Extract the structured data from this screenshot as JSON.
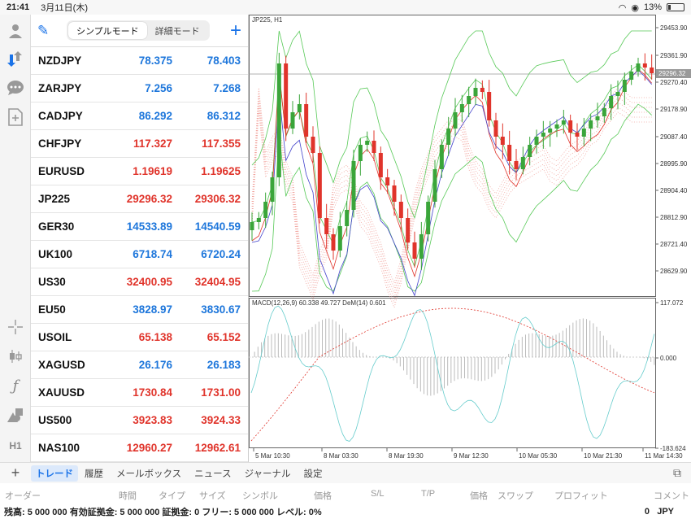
{
  "status_bar": {
    "time": "21:41",
    "date": "3月11日(木)",
    "battery": "13%"
  },
  "toolbar": {
    "items": [
      "account-icon",
      "trade-icon",
      "chat-icon",
      "new-document-icon",
      "crosshair-icon",
      "candlestick-icon",
      "function-icon",
      "objects-icon"
    ],
    "timeframe": "H1"
  },
  "quotes": {
    "mode_simple": "シンプルモード",
    "mode_detail": "詳細モード",
    "rows": [
      {
        "symbol": "NZDJPY",
        "bid": "78.375",
        "ask": "78.403",
        "dir": "up"
      },
      {
        "symbol": "ZARJPY",
        "bid": "7.256",
        "ask": "7.268",
        "dir": "up"
      },
      {
        "symbol": "CADJPY",
        "bid": "86.292",
        "ask": "86.312",
        "dir": "up"
      },
      {
        "symbol": "CHFJPY",
        "bid": "117.327",
        "ask": "117.355",
        "dir": "down"
      },
      {
        "symbol": "EURUSD",
        "bid": "1.19619",
        "ask": "1.19625",
        "dir": "down"
      },
      {
        "symbol": "JP225",
        "bid": "29296.32",
        "ask": "29306.32",
        "dir": "down"
      },
      {
        "symbol": "GER30",
        "bid": "14533.89",
        "ask": "14540.59",
        "dir": "up"
      },
      {
        "symbol": "UK100",
        "bid": "6718.74",
        "ask": "6720.24",
        "dir": "up"
      },
      {
        "symbol": "US30",
        "bid": "32400.95",
        "ask": "32404.95",
        "dir": "down"
      },
      {
        "symbol": "EU50",
        "bid": "3828.97",
        "ask": "3830.67",
        "dir": "up"
      },
      {
        "symbol": "USOIL",
        "bid": "65.138",
        "ask": "65.152",
        "dir": "down"
      },
      {
        "symbol": "XAGUSD",
        "bid": "26.176",
        "ask": "26.183",
        "dir": "up"
      },
      {
        "symbol": "XAUUSD",
        "bid": "1730.84",
        "ask": "1731.00",
        "dir": "down"
      },
      {
        "symbol": "US500",
        "bid": "3923.83",
        "ask": "3924.33",
        "dir": "down"
      },
      {
        "symbol": "NAS100",
        "bid": "12960.27",
        "ask": "12962.61",
        "dir": "down"
      }
    ]
  },
  "chart": {
    "title": "JP225, H1",
    "current_price": "29296.32",
    "price_ticks": [
      "29453.90",
      "29361.90",
      "29270.40",
      "29178.90",
      "29087.40",
      "28995.90",
      "28904.40",
      "28812.90",
      "28721.40",
      "28629.90"
    ],
    "macd_label": "MACD(12,26,9) 60.338 49.727 DeM(14) 0.601",
    "macd_ticks": [
      "117.072",
      "0.000",
      "-183.624"
    ],
    "time_ticks": [
      "5 Mar 10:30",
      "8 Mar 03:30",
      "8 Mar 19:30",
      "9 Mar 12:30",
      "10 Mar 05:30",
      "10 Mar 21:30",
      "11 Mar 14:30"
    ]
  },
  "tabs": {
    "items": [
      "トレード",
      "履歴",
      "メールボックス",
      "ニュース",
      "ジャーナル",
      "設定"
    ],
    "active": "トレード"
  },
  "columns": [
    "オーダー",
    "時間",
    "タイプ",
    "サイズ",
    "シンボル",
    "価格",
    "S/L",
    "T/P",
    "価格",
    "スワップ",
    "プロフィット",
    "コメント"
  ],
  "footer": {
    "summary": "残高: 5 000 000 有効証拠金: 5 000 000 証拠金: 0 フリー: 5 000 000 レベル: 0%",
    "profit": "0",
    "currency": "JPY"
  },
  "colors": {
    "up": "#1d76db",
    "down": "#e0342b",
    "bull_candle": "#3aa53a",
    "bear_candle": "#e0342b"
  }
}
